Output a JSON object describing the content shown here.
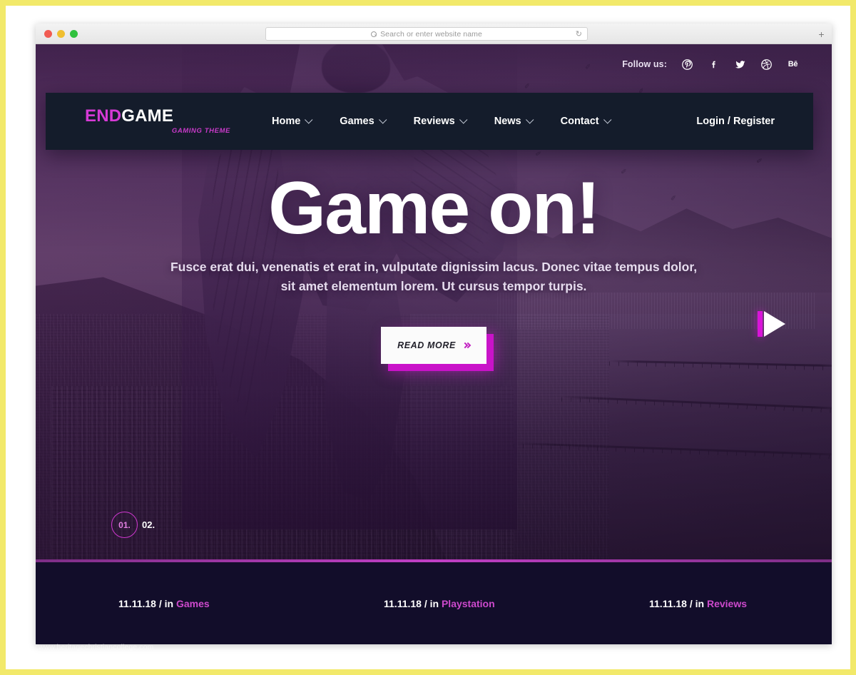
{
  "browser": {
    "search": {
      "placeholder": "Search or enter website name",
      "icon": "search-icon"
    },
    "reload_icon": "reload-icon",
    "newtab_label": "+",
    "traffic_lights": [
      "close",
      "minimize",
      "maximize"
    ]
  },
  "topbar": {
    "follow_label": "Follow us:",
    "socials": [
      {
        "name": "pinterest-icon",
        "glyph": "P"
      },
      {
        "name": "facebook-icon",
        "glyph": "f"
      },
      {
        "name": "twitter-icon",
        "glyph": "t"
      },
      {
        "name": "dribbble-icon",
        "glyph": "d"
      },
      {
        "name": "behance-icon",
        "glyph": "Bē"
      }
    ]
  },
  "nav": {
    "logo": {
      "part1": "END",
      "part2": "GAME",
      "tagline": "GAMING THEME"
    },
    "menu": [
      {
        "label": "Home"
      },
      {
        "label": "Games"
      },
      {
        "label": "Reviews"
      },
      {
        "label": "News"
      },
      {
        "label": "Contact"
      }
    ],
    "login_label": "Login / Register"
  },
  "hero": {
    "title": "Game on!",
    "subtitle_line1": "Fusce erat dui, venenatis et erat in, vulputate dignissim lacus. Donec vitae tempus dolor,",
    "subtitle_line2": "sit amet elementum lorem. Ut cursus tempor turpis.",
    "cta_label": "READ MORE",
    "pager": [
      {
        "label": "01.",
        "active": true
      },
      {
        "label": "02.",
        "active": false
      }
    ],
    "next_icon": "play-next-icon"
  },
  "news": [
    {
      "date": "11.11.18",
      "separator": "/ in",
      "category": "Games"
    },
    {
      "date": "11.11.18",
      "separator": "/ in",
      "category": "Playstation"
    },
    {
      "date": "11.11.18",
      "separator": "/ in",
      "category": "Reviews"
    }
  ],
  "watermark": "www.heritagechristiancollege.com",
  "colors": {
    "accent_magenta": "#c913c9",
    "accent_pink": "#cc49cc",
    "nav_dark": "#141c2b",
    "news_dark": "#120d2a",
    "frame_yellow": "#f2e96a"
  }
}
